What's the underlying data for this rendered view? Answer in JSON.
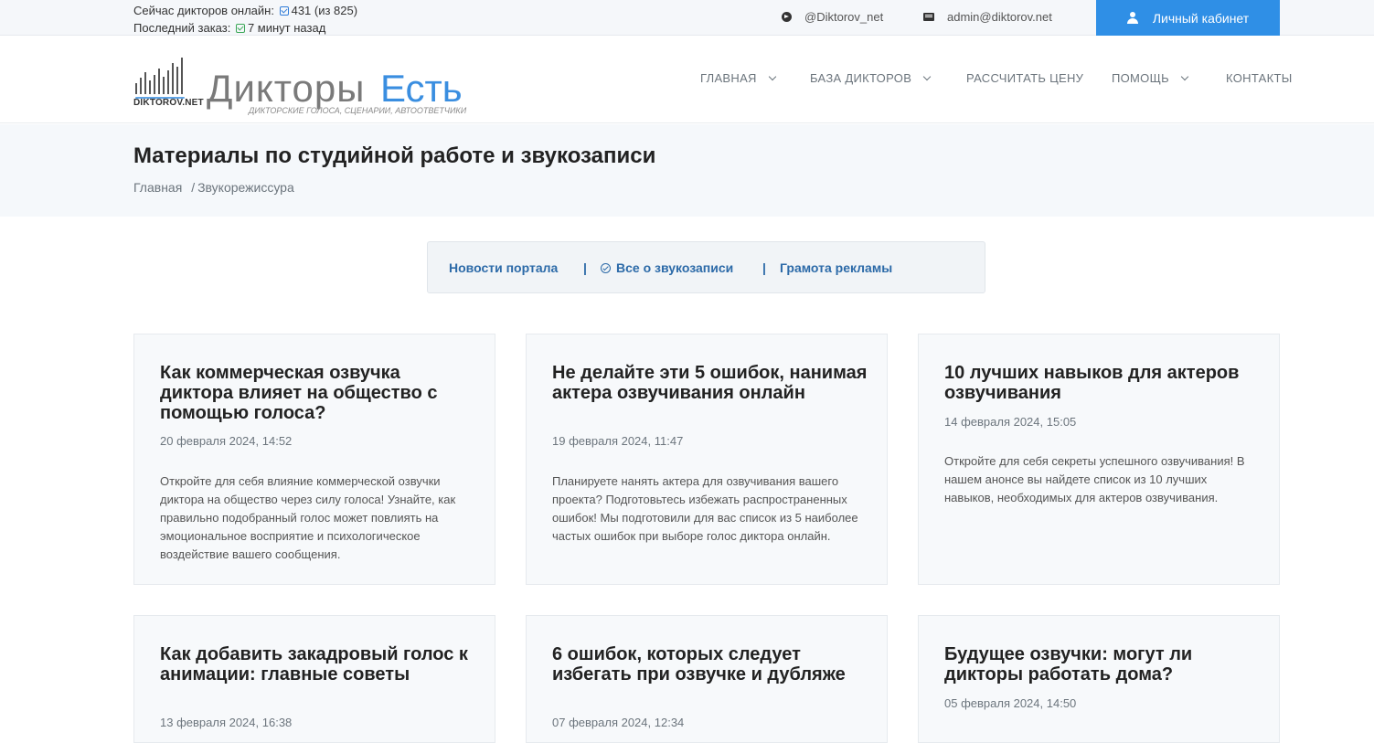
{
  "topbar": {
    "online_label": "Сейчас дикторов онлайн:",
    "online_value": "431 (из 825)",
    "last_order_label": "Последний заказ:",
    "last_order_value": "7 минут назад",
    "telegram": "@Diktorov_net",
    "email": "admin@diktorov.net",
    "cabinet_button": "Личный кабинет"
  },
  "logo": {
    "small_text": "DIKTOROV.NET",
    "main_text_gray": "Дикторы",
    "main_text_blue": "Есть",
    "tagline": "ДИКТОРСКИЕ ГОЛОСА, СЦЕНАРИИ, АВТООТВЕТЧИКИ"
  },
  "nav": {
    "items": [
      {
        "label": "ГЛАВНАЯ",
        "dropdown": true
      },
      {
        "label": "БАЗА ДИКТОРОВ",
        "dropdown": true
      },
      {
        "label": "РАССЧИТАТЬ ЦЕНУ",
        "dropdown": false
      },
      {
        "label": "ПОМОЩЬ",
        "dropdown": true
      },
      {
        "label": "КОНТАКТЫ",
        "dropdown": false
      }
    ]
  },
  "page": {
    "title": "Материалы по студийной работе и звукозаписи",
    "breadcrumb_home": "Главная",
    "breadcrumb_sep": "/",
    "breadcrumb_current": "Звукорежиссура"
  },
  "filter": {
    "items": [
      "Новости портала",
      "Все о звукозаписи",
      "Грамота рекламы"
    ],
    "separator": "|"
  },
  "cards": [
    {
      "title": "Как коммерческая озвучка диктора влияет на общество с помощью голоса?",
      "date": "20 февраля 2024, 14:52",
      "text": "Откройте для себя влияние коммерческой озвучки диктора на общество через силу голоса! Узнайте, как правильно подобранный голос может повлиять на эмоциональное восприятие и психологическое воздействие вашего сообщения."
    },
    {
      "title": "Не делайте эти 5 ошибок, нанимая актера озвучивания онлайн",
      "date": "19 февраля 2024, 11:47",
      "text": "Планируете нанять актера для озвучивания вашего проекта? Подготовьтесь избежать распространенных ошибок! Мы подготовили для вас список из 5 наиболее частых ошибок при выборе голос диктора онлайн."
    },
    {
      "title": "10 лучших навыков для актеров озвучивания",
      "date": "14 февраля 2024, 15:05",
      "text": "Откройте для себя секреты успешного озвучивания! В нашем анонсе вы найдете список из 10 лучших навыков, необходимых для актеров озвучивания."
    },
    {
      "title": "Как добавить закадровый голос к анимации: главные советы",
      "date": "13 февраля 2024, 16:38",
      "text": ""
    },
    {
      "title": "6 ошибок, которых следует избегать при озвучке и дубляже",
      "date": "07 февраля 2024, 12:34",
      "text": ""
    },
    {
      "title": "Будущее озвучки: могут ли дикторы работать дома?",
      "date": "05 февраля 2024, 14:50",
      "text": ""
    }
  ],
  "colors": {
    "accent": "#2f8fe6",
    "link": "#2c6aa8",
    "logo_blue": "#3a8ee0"
  }
}
